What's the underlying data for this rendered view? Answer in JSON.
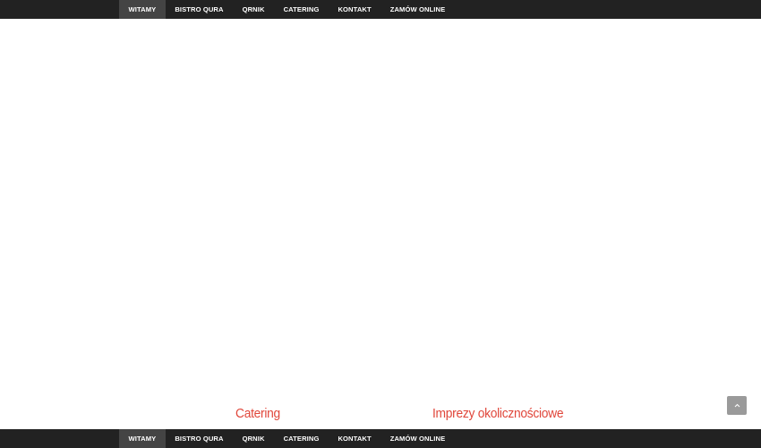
{
  "nav": {
    "items": [
      {
        "label": "WITAMY",
        "active": true
      },
      {
        "label": "BISTRO QURA",
        "active": false
      },
      {
        "label": "QRNIK",
        "active": false
      },
      {
        "label": "CATERING",
        "active": false
      },
      {
        "label": "KONTAKT",
        "active": false
      },
      {
        "label": "ZAMÓW ONLINE",
        "active": false
      }
    ]
  },
  "sections": {
    "catering_title": "Catering",
    "imprezy_title": "Imprezy okolicznościowe"
  },
  "scroll_top": {
    "icon": "chevron-up-icon"
  },
  "colors": {
    "nav_background": "#222222",
    "nav_active": "#444444",
    "accent": "#e0463a",
    "scroll_button": "#9a9a9a"
  }
}
